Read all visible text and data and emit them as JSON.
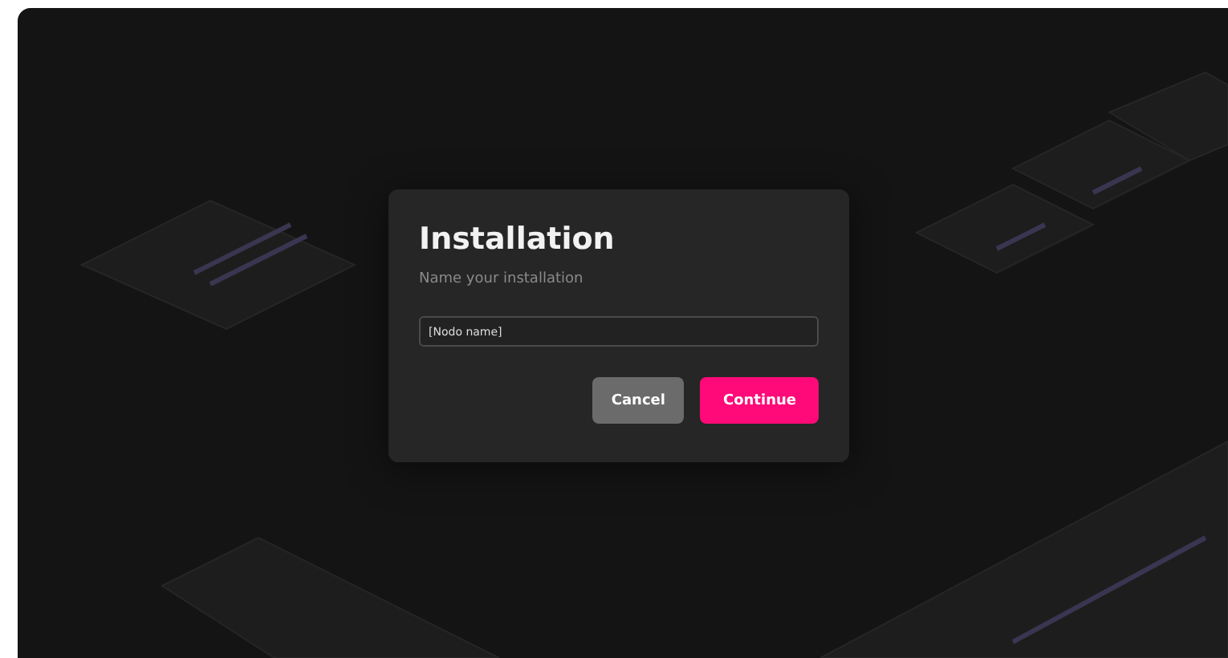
{
  "dialog": {
    "title": "Installation",
    "subtitle": "Name your installation",
    "name_field": {
      "value": "[Nodo name]"
    },
    "buttons": [
      {
        "label": "Cancel",
        "kind": "secondary"
      },
      {
        "label": "Continue",
        "kind": "primary"
      }
    ]
  }
}
